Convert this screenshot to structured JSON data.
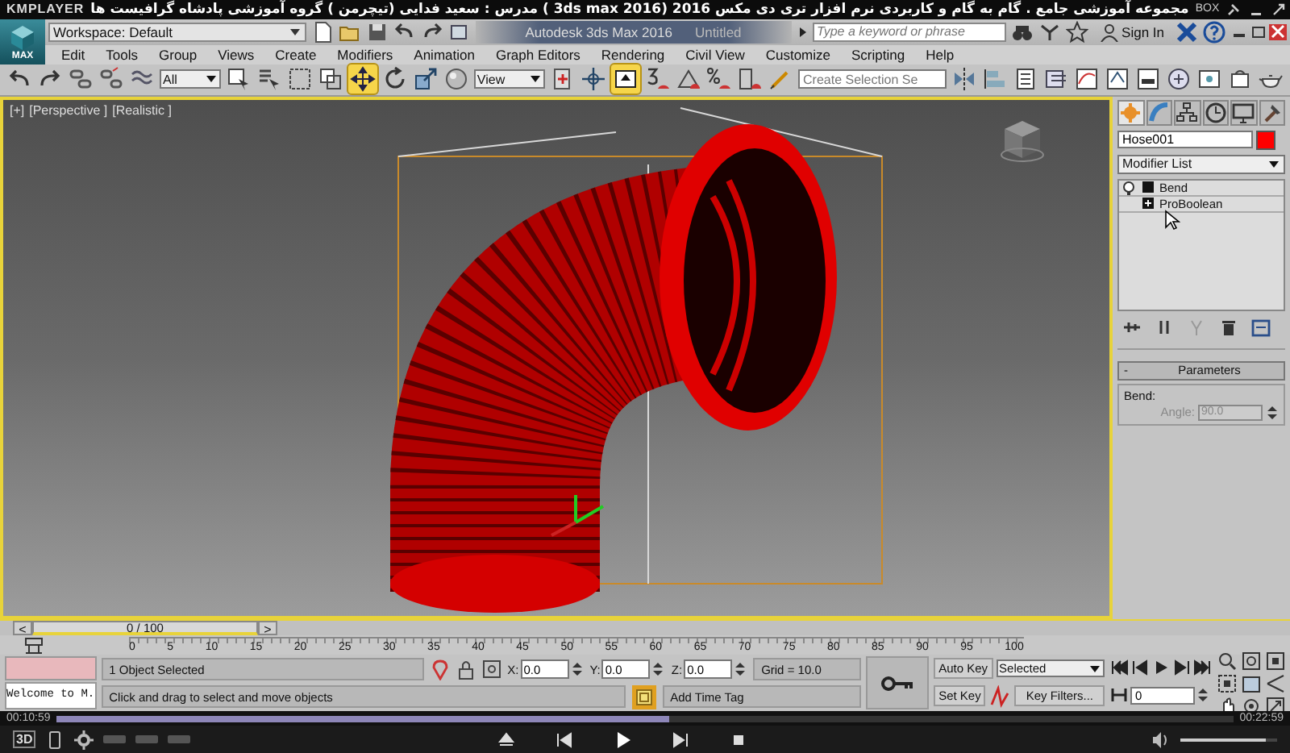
{
  "player": {
    "brand": "KMPLAYER",
    "title": "مجموعه آموزشی جامع . گام به گام و کاربردی نرم افزار تری دی مکس 2016 (3ds max 2016 ) مدرس : سعید فدایی (تیچرمن ) گروه آموزشی پادشاه گرافیست ها",
    "badge": "BOX",
    "elapsed": "00:10:59",
    "total": "00:22:59",
    "progress": {
      "level": 0.52
    },
    "volume": {
      "level": 0.88
    },
    "mode": "3D"
  },
  "app": {
    "logo": "MAX",
    "workspace": "Workspace: Default",
    "title": "Autodesk 3ds Max 2016",
    "document": "Untitled",
    "search": {
      "placeholder": "Type a keyword or phrase"
    },
    "sign_in": "Sign In"
  },
  "menu": [
    "Edit",
    "Tools",
    "Group",
    "Views",
    "Create",
    "Modifiers",
    "Animation",
    "Graph Editors",
    "Rendering",
    "Civil View",
    "Customize",
    "Scripting",
    "Help"
  ],
  "toolbar": {
    "selection_filter": "All",
    "reference_coordinates": "View",
    "named_selection": {
      "placeholder": "Create Selection Se"
    },
    "move_tool": {
      "selected": true
    },
    "keyboard_override": {
      "selected": true
    }
  },
  "viewport": {
    "labels": [
      "[+]",
      "[Perspective ]",
      "[Realistic ]"
    ],
    "active": true
  },
  "command_panel": {
    "tabs": [
      {
        "selected": true
      },
      {
        "selected": false
      },
      {
        "selected": false
      },
      {
        "selected": false
      },
      {
        "selected": false
      },
      {
        "selected": false
      }
    ],
    "object_name": "Hose001",
    "modifier_list": "Modifier List",
    "stack": [
      {
        "label": "Bend",
        "kind": "modifier",
        "selected": false
      },
      {
        "label": "ProBoolean",
        "kind": "object",
        "selected": false
      }
    ],
    "rollout": {
      "toggle": "-",
      "title": "Parameters",
      "group": "Bend:",
      "field": {
        "label": "Angle:",
        "value": "90.0",
        "disabled": true
      }
    }
  },
  "timeline": {
    "previous": "<",
    "position": "0 / 100",
    "next": ">",
    "ruler": [
      "0",
      "5",
      "10",
      "15",
      "20",
      "25",
      "30",
      "35",
      "40",
      "45",
      "50",
      "55",
      "60",
      "65",
      "70",
      "75",
      "80",
      "85",
      "90",
      "95",
      "100"
    ]
  },
  "status": {
    "listener": "Welcome to M.",
    "selection": "1 Object Selected",
    "prompt": "Click and drag to select and move objects",
    "coordinates": [
      {
        "axis": "X:",
        "value": "0.0"
      },
      {
        "axis": "Y:",
        "value": "0.0"
      },
      {
        "axis": "Z:",
        "value": "0.0"
      }
    ],
    "grid": "Grid = 10.0",
    "time_tag": "Add Time Tag",
    "auto_key": {
      "label": "Auto Key",
      "on": false
    },
    "key_mode": "Selected",
    "set_key": "Set Key",
    "key_filters": "Key Filters...",
    "frame": "0"
  }
}
